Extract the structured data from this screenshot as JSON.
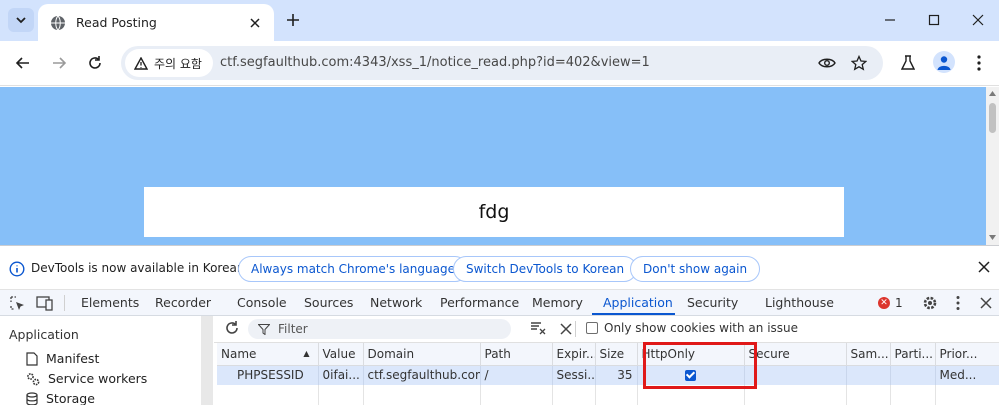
{
  "browser": {
    "tab_title": "Read Posting",
    "security_chip": "주의 요함",
    "url": "ctf.segfaulthub.com:4343/xss_1/notice_read.php?id=402&view=1"
  },
  "page": {
    "content_text": "fdg",
    "background_color": "#86bff8"
  },
  "infobar": {
    "message": "DevTools is now available in Korean!",
    "buttons": [
      "Always match Chrome's language",
      "Switch DevTools to Korean",
      "Don't show again"
    ]
  },
  "devtools": {
    "tabs": [
      "Elements",
      "Recorder",
      "Console",
      "Sources",
      "Network",
      "Performance",
      "Memory",
      "Application",
      "Security",
      "Lighthouse"
    ],
    "active_tab": "Application",
    "error_count": "1",
    "sidebar": {
      "heading": "Application",
      "items": [
        "Manifest",
        "Service workers",
        "Storage"
      ]
    },
    "filter_placeholder": "Filter",
    "only_issue_label": "Only show cookies with an issue",
    "cookie_columns": [
      "Name",
      "Value",
      "Domain",
      "Path",
      "Expir...",
      "Size",
      "HttpOnly",
      "Secure",
      "Sam...",
      "Parti...",
      "Prior..."
    ],
    "cookie_row": {
      "name": "PHPSESSID",
      "value": "0ifai...",
      "domain": "ctf.segfaulthub.com",
      "path": "/",
      "expires": "Sessi...",
      "size": "35",
      "httponly": true,
      "secure": "",
      "samesite": "",
      "partition": "",
      "priority": "Med..."
    }
  },
  "colors": {
    "accent": "#0b57d0",
    "highlight_border": "#e01919"
  }
}
